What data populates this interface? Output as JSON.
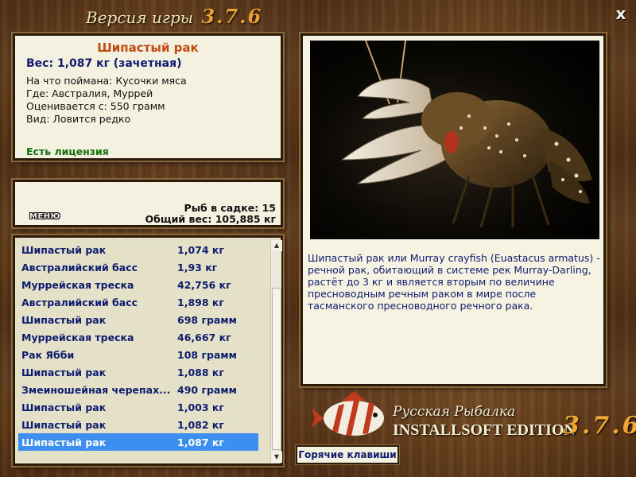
{
  "window": {
    "title": "Версия игры",
    "version": "3.7.6",
    "close_label": "x"
  },
  "fish_info": {
    "name": "Шипастый рак",
    "weight": "Вес: 1,087 кг (зачетная)",
    "lines": [
      "На что поймана: Кусочки мяса",
      "Где: Австралия, Муррей",
      "Оценивается с: 550 грамм",
      "Вид: Ловится редко"
    ],
    "license": "Есть лицензия"
  },
  "cage": {
    "menu_label": "МЕНЮ",
    "fish_count": "Рыб в садке: 15",
    "total_weight": "Общий вес: 105,885 кг"
  },
  "catch_list": [
    {
      "name": "Шипастый рак",
      "weight": "1,074 кг"
    },
    {
      "name": "Австралийский басс",
      "weight": "1,93 кг"
    },
    {
      "name": "Муррейская треска",
      "weight": "42,756 кг"
    },
    {
      "name": "Австралийский басс",
      "weight": "1,898 кг"
    },
    {
      "name": "Шипастый рак",
      "weight": "698 грамм"
    },
    {
      "name": "Муррейская треска",
      "weight": "46,667 кг"
    },
    {
      "name": "Рак Ябби",
      "weight": "108 грамм"
    },
    {
      "name": "Шипастый рак",
      "weight": "1,088 кг"
    },
    {
      "name": "Змеиношейная черепах...",
      "weight": "490 грамм"
    },
    {
      "name": "Шипастый рак",
      "weight": "1,003 кг"
    },
    {
      "name": "Шипастый рак",
      "weight": "1,082 кг"
    },
    {
      "name": "Шипастый рак",
      "weight": "1,087 кг",
      "selected": true
    }
  ],
  "scrollbar": {
    "up_icon": "triangle-up-icon",
    "down_icon": "triangle-down-icon"
  },
  "description": "Шипастый рак или Murray crayfish (Euastacus armatus) - речной рак, обитающий в системе рек Murray-Darling, растёт до 3 кг и является вторым по величине пресноводным речным раком в мире после тасманского пресноводного речного рака.",
  "logo": {
    "title": "Русская Рыбалка",
    "edition": "INSTALLSOFT EDITION",
    "version": "3.7.6"
  },
  "hotkeys_label": "Горячие клавиши",
  "colors": {
    "accent_title": "#c04a10",
    "text_blue": "#0e1c6e",
    "license_green": "#157010",
    "selection": "#3c8ff0",
    "version_orange": "#f0a832"
  }
}
